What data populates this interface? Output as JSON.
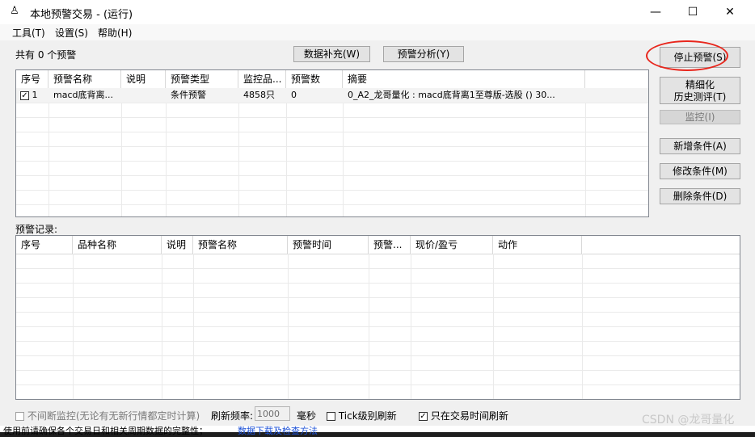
{
  "window": {
    "title": "本地预警交易 - (运行)",
    "minimize_glyph": "—",
    "maximize_glyph": "☐",
    "close_glyph": "✕"
  },
  "menu": {
    "tools": "工具(T)",
    "settings": "设置(S)",
    "help": "帮助(H)"
  },
  "summary": {
    "total_text": "共有 0 个预警"
  },
  "toolbar": {
    "fill_data": "数据补充(W)",
    "analysis": "预警分析(Y)"
  },
  "side_buttons": {
    "stop": "停止预警(S)",
    "refine_line1": "精细化",
    "refine_line2": "历史测评(T)",
    "monitor": "监控(I)",
    "add": "新增条件(A)",
    "modify": "修改条件(M)",
    "delete": "删除条件(D)"
  },
  "alerts_table": {
    "columns": [
      "序号",
      "预警名称",
      "说明",
      "预警类型",
      "监控品...",
      "预警数",
      "摘要"
    ],
    "rows": [
      {
        "checked": true,
        "index": "1",
        "name": "macd底背离...",
        "desc": "",
        "type": "条件预警",
        "monitored": "4858只",
        "count": "0",
        "summary": "0_A2_龙哥量化 : macd底背离1至尊版-选股 () 30..."
      }
    ]
  },
  "records": {
    "label": "预警记录:",
    "columns": [
      "序号",
      "品种名称",
      "说明",
      "预警名称",
      "预警时间",
      "预警...",
      "现价/盈亏",
      "动作"
    ]
  },
  "footer": {
    "continuous_label": "不间断监控(无论有无新行情都定时计算)",
    "continuous_checked": false,
    "refresh_label": "刷新频率:",
    "refresh_value": "1000",
    "unit": "毫秒",
    "tick_label": "Tick级别刷新",
    "tick_checked": false,
    "trading_only_label": "只在交易时间刷新",
    "trading_only_checked": true
  },
  "background": {
    "bottom_text": "使用前请确保各个交易日和相关周期数据的完整性；",
    "bottom_link": "数据下载及检查方法",
    "watermark": "CSDN @龙哥量化"
  },
  "colors": {
    "accent_red": "#e8261c",
    "window_bg": "#f0f0f0",
    "link_blue": "#1a4fd6"
  }
}
